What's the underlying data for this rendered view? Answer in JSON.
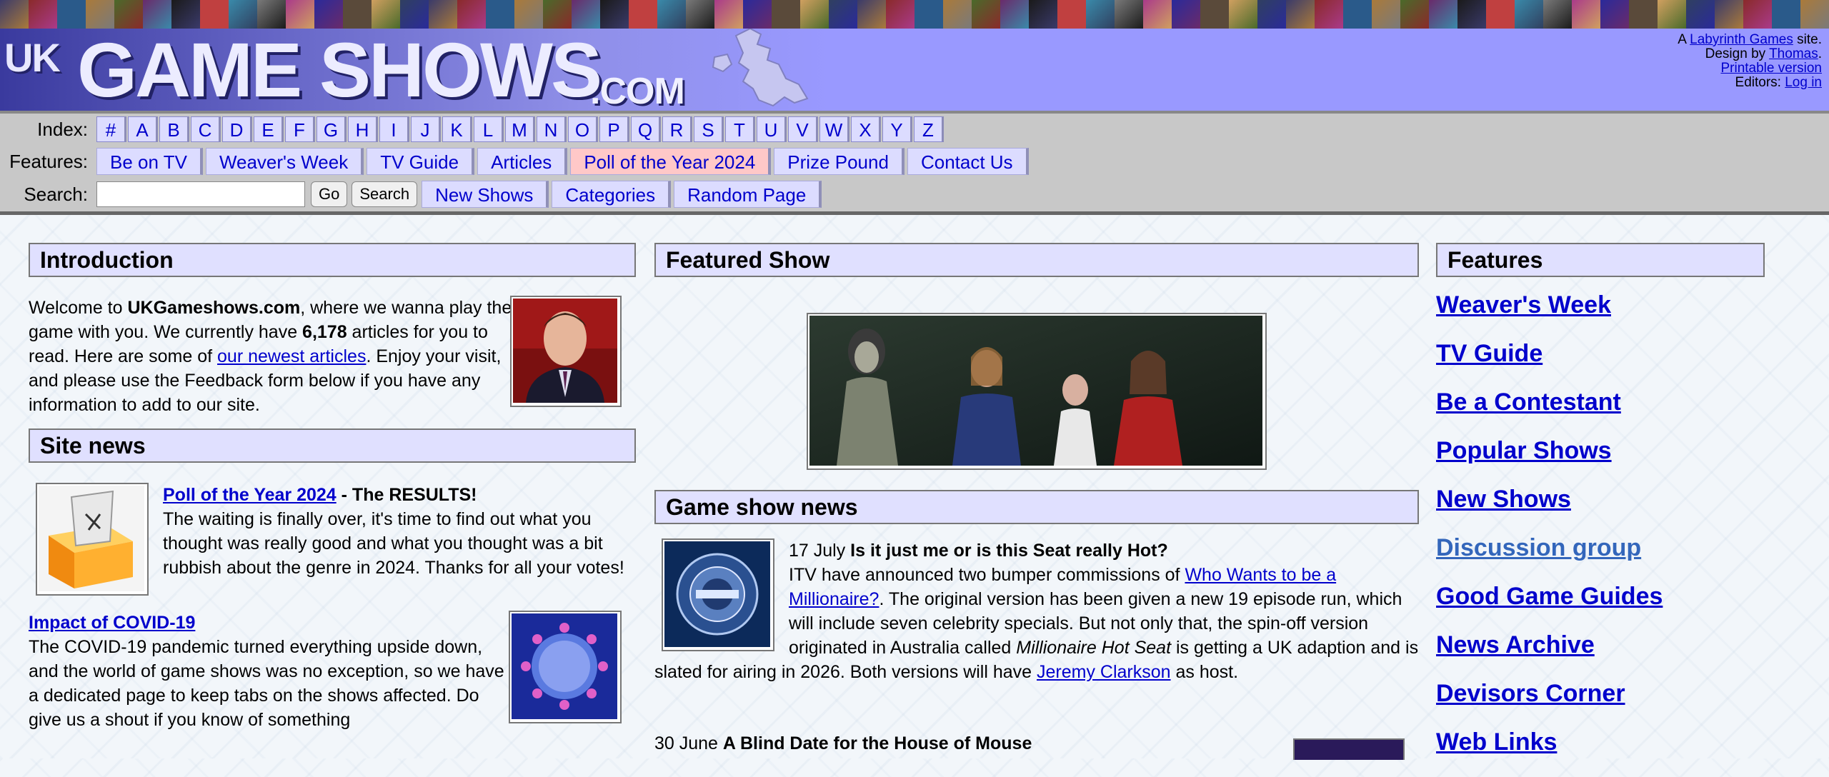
{
  "header": {
    "logo_uk": "UK",
    "logo_main": "GAME SHOWS",
    "logo_com": ".COM",
    "credit_prefix": "A",
    "credit_link": "Labyrinth Games",
    "credit_suffix": "site.",
    "design_prefix": "Design by",
    "design_link": "Thomas",
    "design_suffix": ".",
    "printable": "Printable version",
    "editors_prefix": "Editors:",
    "login": "Log in"
  },
  "nav": {
    "index_label": "Index:",
    "letters": [
      "#",
      "A",
      "B",
      "C",
      "D",
      "E",
      "F",
      "G",
      "H",
      "I",
      "J",
      "K",
      "L",
      "M",
      "N",
      "O",
      "P",
      "Q",
      "R",
      "S",
      "T",
      "U",
      "V",
      "W",
      "X",
      "Y",
      "Z"
    ],
    "features_label": "Features:",
    "features": [
      "Be on TV",
      "Weaver's Week",
      "TV Guide",
      "Articles",
      "Poll of the Year 2024",
      "Prize Pound",
      "Contact Us"
    ],
    "search_label": "Search:",
    "search_value": "",
    "go_label": "Go",
    "search_button": "Search",
    "extra_tabs": [
      "New Shows",
      "Categories",
      "Random Page"
    ]
  },
  "intro": {
    "title": "Introduction",
    "t1": "Welcome to ",
    "site": "UKGameshows.com",
    "t2": ", where we wanna play the game with you. We currently have ",
    "count": "6,178",
    "t3": " articles for you to read. Here are some of ",
    "link": "our newest articles",
    "t4": ". Enjoy your visit, and please use the Feedback form below if you have any information to add to our site."
  },
  "site_news": {
    "title": "Site news",
    "poll_link": "Poll of the Year 2024",
    "poll_rest": " - The RESULTS!",
    "poll_body": "The waiting is finally over, it's time to find out what you thought was really good and what you thought was a bit rubbish about the genre in 2024. Thanks for all your votes!",
    "covid_link": "Impact of COVID-19",
    "covid_body": "The COVID-19 pandemic turned everything upside down, and the world of game shows was no exception, so we have a dedicated page to keep tabs on the shows affected. Do give us a shout if you know of something"
  },
  "featured": {
    "title": "Featured Show"
  },
  "news": {
    "title": "Game show news",
    "item1_date": "17 July",
    "item1_headline": "Is it just me or is this Seat really Hot?",
    "item1_t1": "ITV have announced two bumper commissions of ",
    "item1_link1": "Who Wants to be a Millionaire?",
    "item1_t2": ". The original version has been given a new 19 episode run, which will include seven celebrity specials. But not only that, the spin-off version originated in Australia called ",
    "item1_italic": "Millionaire Hot Seat",
    "item1_t3": " is getting a UK adaption and is slated for airing in 2026. Both versions will have ",
    "item1_link2": "Jeremy Clarkson",
    "item1_t4": " as host.",
    "item2_date": "30 June",
    "item2_headline": "A Blind Date for the House of Mouse"
  },
  "features_col": {
    "title": "Features",
    "links": [
      "Weaver's Week",
      "TV Guide",
      "Be a Contestant",
      "Popular Shows",
      "New Shows",
      "Discussion group",
      "Good Game Guides",
      "News Archive",
      "Devisors Corner",
      "Web Links"
    ]
  },
  "colors": {
    "header_bg": "#9999ff",
    "nav_bg": "#c8c8c8",
    "section_header_bg": "#e0e0ff",
    "link": "#0000cc",
    "highlight_tab": "#ffc8c8",
    "visited_link": "#3366bb"
  }
}
